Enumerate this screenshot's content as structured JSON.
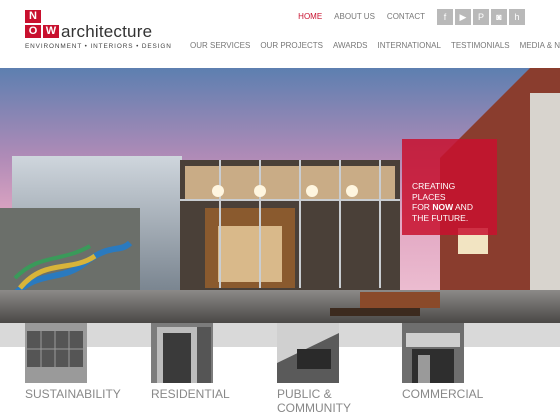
{
  "brand": {
    "logo_letters": [
      "N",
      "O",
      "W"
    ],
    "logo_word": "architecture",
    "tagline": "ENVIRONMENT • INTERIORS • DESIGN"
  },
  "top_nav": [
    {
      "label": "HOME",
      "active": true
    },
    {
      "label": "ABOUT US",
      "active": false
    },
    {
      "label": "CONTACT",
      "active": false
    }
  ],
  "social": [
    {
      "icon": "facebook-icon",
      "glyph": "f"
    },
    {
      "icon": "youtube-icon",
      "glyph": "▶"
    },
    {
      "icon": "pinterest-icon",
      "glyph": "P"
    },
    {
      "icon": "instagram-icon",
      "glyph": "◙"
    },
    {
      "icon": "houzz-icon",
      "glyph": "h"
    }
  ],
  "main_nav": [
    "OUR SERVICES",
    "OUR PROJECTS",
    "AWARDS",
    "INTERNATIONAL",
    "TESTIMONIALS",
    "MEDIA & NEWS"
  ],
  "hero": {
    "callout_lines": [
      "CREATING",
      "PLACES",
      "FOR",
      "NOW",
      "AND",
      "THE FUTURE."
    ]
  },
  "categories": [
    {
      "label": "SUSTAINABILITY",
      "label2": ""
    },
    {
      "label": "RESIDENTIAL",
      "label2": ""
    },
    {
      "label": "PUBLIC &",
      "label2": "COMMUNITY"
    },
    {
      "label": "COMMERCIAL",
      "label2": ""
    }
  ],
  "colors": {
    "brand_red": "#c8102e",
    "nav_grey": "#777777",
    "social_grey": "#b9b9b9"
  }
}
